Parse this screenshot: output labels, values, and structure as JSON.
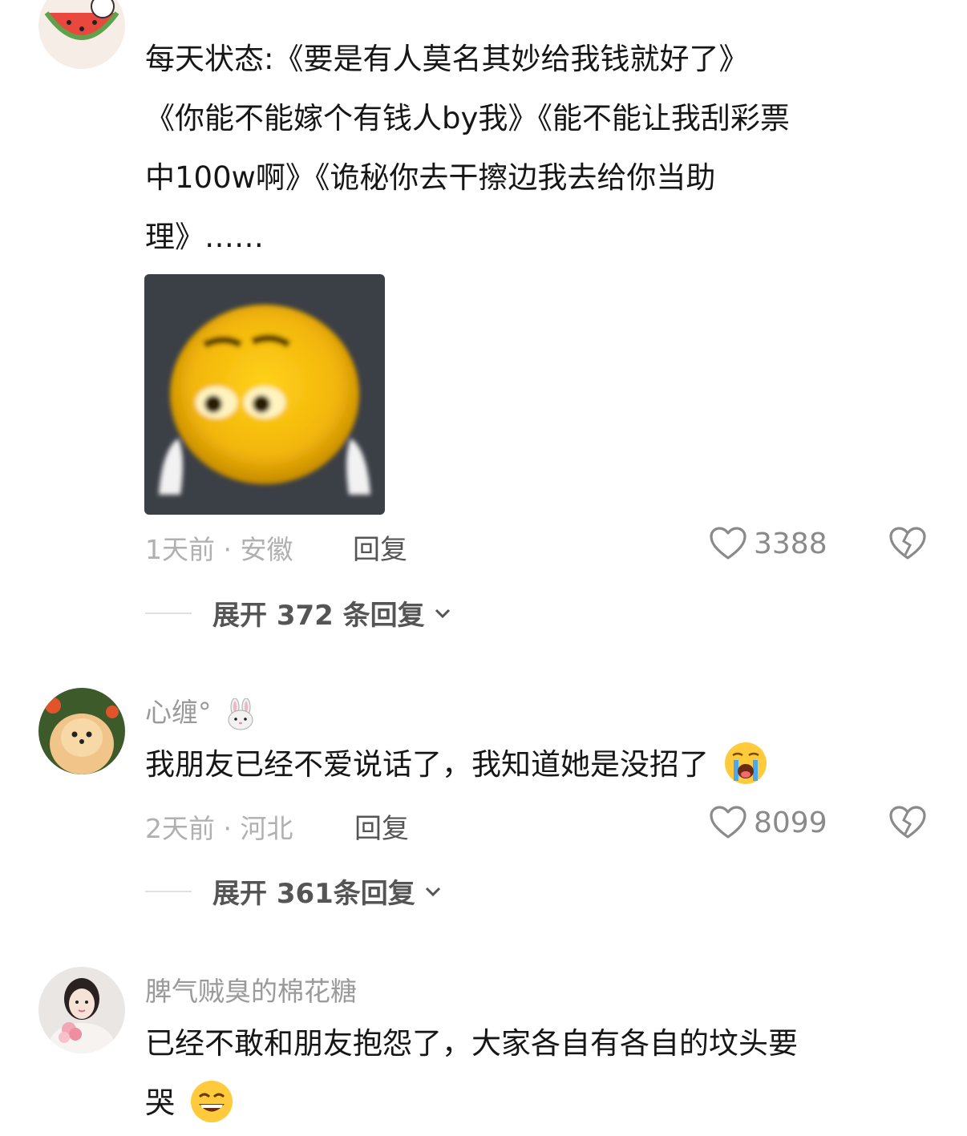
{
  "comments": [
    {
      "username": "",
      "text_lines": [
        "每天状态:《要是有人莫名其妙给我钱就好了》",
        "《你能不能嫁个有钱人by我》《能不能让我刮彩票",
        "中100w啊》《诡秘你去干擦边我去给你当助",
        "理》……"
      ],
      "has_sticker": true,
      "time": "1天前",
      "location": "安徽",
      "meta": "1天前 · 安徽",
      "reply_label": "回复",
      "likes": "3388",
      "expand_label": "展开 372 条回复"
    },
    {
      "username": "心缠°",
      "text": "我朋友已经不爱说话了，我知道她是没招了",
      "meta": "2天前 · 河北",
      "reply_label": "回复",
      "likes": "8099",
      "expand_label": "展开 361条回复"
    },
    {
      "username": "脾气贼臭的棉花糖",
      "text_lines": [
        "已经不敢和朋友抱怨了，大家各自有各自的坟头要",
        "哭"
      ]
    }
  ],
  "icons": {
    "like": "heart-outline-icon",
    "dislike": "broken-heart-icon",
    "expand": "chevron-down-icon",
    "emoji_crying": "loudly-crying-face-emoji",
    "emoji_grin": "grinning-squinting-face-emoji",
    "emoji_rabbit": "rabbit-face-emoji"
  },
  "colors": {
    "text": "#161616",
    "meta": "#b0b0b0",
    "username": "#9a9a9a",
    "action": "#555555"
  }
}
